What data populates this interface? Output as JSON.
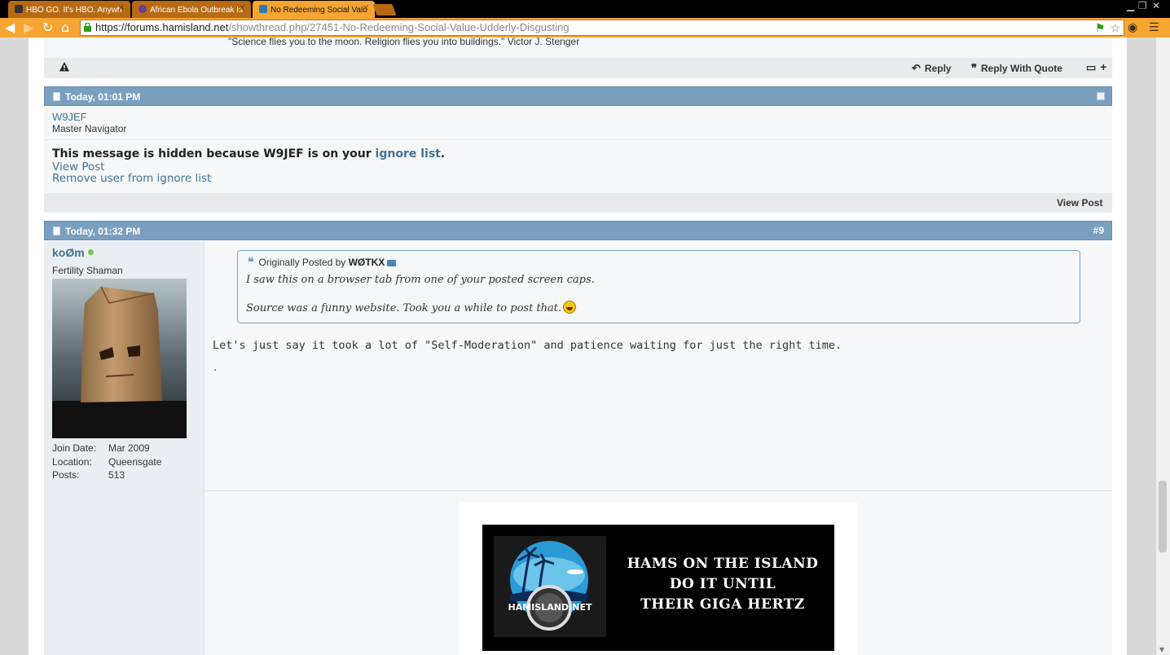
{
  "browser": {
    "tabs": [
      {
        "title": "HBO GO. It's HBO. Anywh",
        "active": false,
        "favicon_color": "#6b3b9b"
      },
      {
        "title": "African Ebola Outbreak Is",
        "active": false,
        "favicon_color": "#6b3b9b"
      },
      {
        "title": "No Redeeming Social Valu",
        "active": true,
        "favicon_color": "#2b7bb8"
      }
    ],
    "close_glyph": "✕",
    "url_host": "https://forums.hamisland.net",
    "url_path": "/showthread.php/27451-No-Redeeming-Social-Value-Udderly-Disgusting"
  },
  "previous_post": {
    "signature": "\"Science flies you to the moon. Religion flies you into buildings.\" Victor J. Stenger",
    "reply_label": "Reply",
    "reply_quote_label": "Reply With Quote",
    "multiquote_label": "+"
  },
  "ignored_post": {
    "date": "Today, 01:01 PM",
    "username": "W9JEF",
    "user_title": "Master Navigator",
    "message_prefix": "This message is hidden because W9JEF is on your",
    "message_link": "ignore list",
    "message_suffix": ".",
    "view_post_link": "View Post",
    "remove_link": "Remove user from ignore list",
    "footer_view_post": "View Post"
  },
  "post": {
    "date": "Today, 01:32 PM",
    "number": "#9",
    "username": "koØm",
    "user_title": "Fertility Shaman",
    "stats": [
      {
        "key": "Join Date:",
        "value": "Mar 2009"
      },
      {
        "key": "Location:",
        "value": "Queensgate"
      },
      {
        "key": "Posts:",
        "value": "513"
      }
    ],
    "quote": {
      "header_prefix": "Originally Posted by",
      "author": "WØTKX",
      "line1": "I saw this on a browser tab from one of your posted screen caps.",
      "line2": "Source was a funny website. Took you a while to post that."
    },
    "message": "Let's just say it took a lot of \"Self-Moderation\" and patience waiting for just the right time.",
    "trailing": ".",
    "banner": {
      "line1": "HAMS ON THE ISLAND",
      "line2": "DO IT UNTIL",
      "line3": "THEIR GIGA HERTZ",
      "logo_text": "HAMISLAND.NET"
    }
  },
  "colors": {
    "chrome_orange": "#f6a531",
    "post_header_blue": "#7a9fbf",
    "link_blue": "#417394"
  }
}
